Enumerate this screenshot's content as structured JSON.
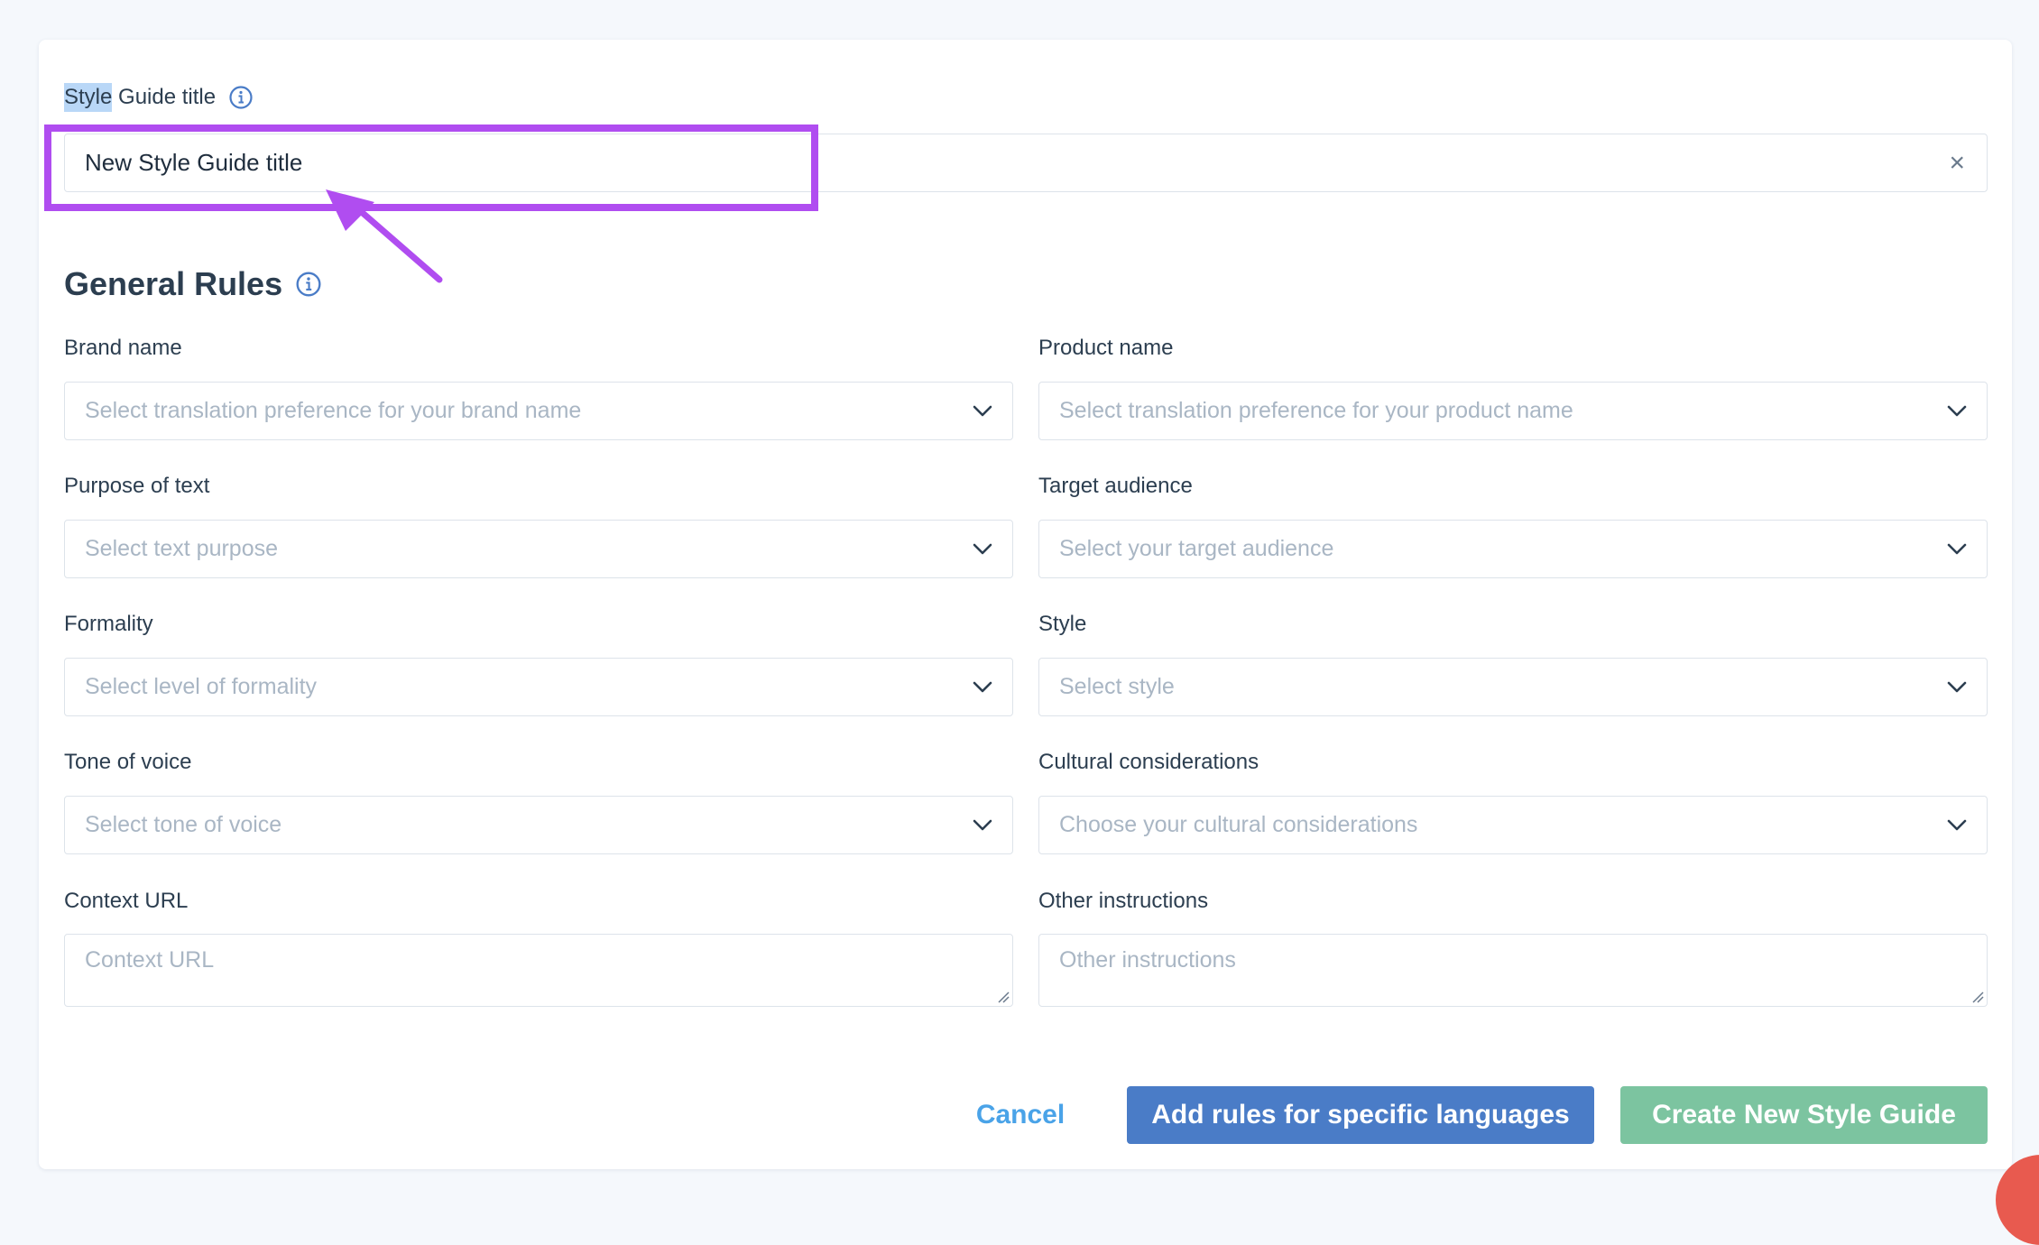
{
  "style_guide_title": {
    "label_highlighted": "Style",
    "label_rest": " Guide title",
    "value": "New Style Guide title",
    "clear_glyph": "×"
  },
  "general_rules": {
    "title": "General Rules"
  },
  "fields": {
    "brand_name": {
      "label": "Brand name",
      "placeholder": "Select translation preference for your brand name"
    },
    "product_name": {
      "label": "Product name",
      "placeholder": "Select translation preference for your product name"
    },
    "purpose": {
      "label": "Purpose of text",
      "placeholder": "Select text purpose"
    },
    "audience": {
      "label": "Target audience",
      "placeholder": "Select your target audience"
    },
    "formality": {
      "label": "Formality",
      "placeholder": "Select level of formality"
    },
    "style": {
      "label": "Style",
      "placeholder": "Select style"
    },
    "tone": {
      "label": "Tone of voice",
      "placeholder": "Select tone of voice"
    },
    "cultural": {
      "label": "Cultural considerations",
      "placeholder": "Choose your cultural considerations"
    },
    "context_url": {
      "label": "Context URL",
      "placeholder": "Context URL"
    },
    "other": {
      "label": "Other instructions",
      "placeholder": "Other instructions"
    }
  },
  "buttons": {
    "cancel": "Cancel",
    "add_rules": "Add rules for specific languages",
    "create": "Create New Style Guide"
  },
  "colors": {
    "highlight_box": "#b04df0",
    "primary_button": "#4a7cc7",
    "create_button": "#7cc4a0",
    "cancel_link": "#4aa3e8",
    "info_icon": "#4a7cc7"
  },
  "icons": {
    "info": "info-circle-icon",
    "chevron": "chevron-down-icon",
    "clear": "close-icon"
  }
}
